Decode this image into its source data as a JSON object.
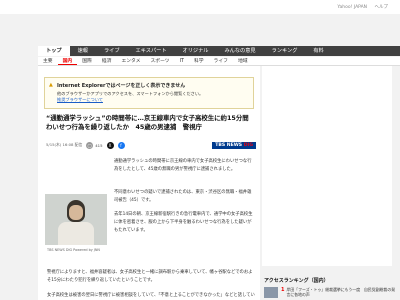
{
  "topbar": {
    "links": [
      "Yahoo! JAPAN",
      "ヘルプ"
    ]
  },
  "globalnav": {
    "items": [
      "トップ",
      "速報",
      "ライブ",
      "エキスパート",
      "オリジナル",
      "みんなの意見",
      "ランキング",
      "有料"
    ]
  },
  "subnav": {
    "items": [
      "主要",
      "国内",
      "国際",
      "経済",
      "エンタメ",
      "スポーツ",
      "IT",
      "科学",
      "ライフ",
      "地域"
    ]
  },
  "notice": {
    "title": "Internet Explorerではページを正しく表示できません",
    "body": "他のブラウザーかアプリでのアクセスを、スマートフォンから閲覧ください。",
    "link": "推奨ブラウザーについて"
  },
  "article": {
    "title": "“通勤通学ラッシュ”の時間帯に…京王線車内で女子高校生に約15分間わいせつ行為を繰り返したか　45歳の男逮捕　警視庁",
    "date": "5/15(木) 16:08 配信",
    "comment_count": "415",
    "source_badge_main": "TBS NEWS",
    "source_badge_accent": "DIG",
    "photo_caption": "TBS NEWS DIG Powered by JNN",
    "para1": "通勤通学ラッシュの時間帯に京王線の車内で女子高校生にわいせつな行為をしたとして、45歳の無職の男が警視庁に逮捕されました。",
    "para2": "不同意わいせつの疑いで逮捕されたのは、東京・渋谷区の無職・福井雄司被告（45）です。",
    "para3": "去年14日の朝、京王線新宿駅行きの急行電車内で、通学中の女子高校生に体を密着させ、服の上から下半身を触るわいせつな行為をした疑いがもたれています。",
    "para4": "警視庁によりますと、福井容疑者は、女子高校生と一緒に調布駅から乗車していて、幡ヶ谷駅などでのおよそ15分にわたり犯行を繰り返していたということです。",
    "para5": "女子高校生は被害の翌日に警視庁に被害相談をしていて、「不意と上ることができなかった」などと話しているということです。"
  },
  "sidebar": {
    "ranking_title": "アクセスランキング（国内）",
    "ranking": [
      {
        "rank": "1",
        "text": "岸田「フーズ・トゥ」総裁選挙にもう一度　自民党副総裁の発言に各地の声"
      }
    ]
  },
  "colors": {
    "nav_bg": "#404040",
    "accent": "#e00000",
    "link": "#1a5dc8"
  }
}
